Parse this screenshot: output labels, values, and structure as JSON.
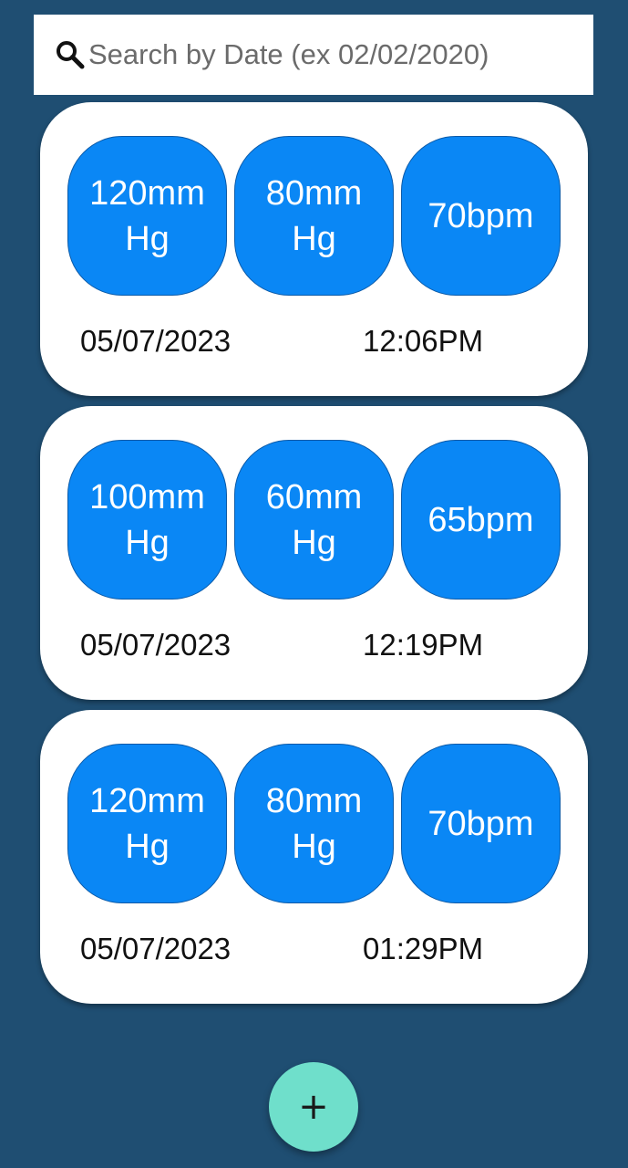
{
  "search": {
    "placeholder": "Search by Date (ex 02/02/2020)",
    "icon": "search-icon"
  },
  "records": [
    {
      "systolic": [
        "120mm",
        "Hg"
      ],
      "diastolic": [
        "80mm",
        "Hg"
      ],
      "pulse": "70bpm",
      "date": "05/07/2023",
      "time": "12:06PM"
    },
    {
      "systolic": [
        "100mm",
        "Hg"
      ],
      "diastolic": [
        "60mm",
        "Hg"
      ],
      "pulse": "65bpm",
      "date": "05/07/2023",
      "time": "12:19PM"
    },
    {
      "systolic": [
        "120mm",
        "Hg"
      ],
      "diastolic": [
        "80mm",
        "Hg"
      ],
      "pulse": "70bpm",
      "date": "05/07/2023",
      "time": "01:29PM"
    }
  ],
  "fab": {
    "label": "+",
    "icon": "plus-icon"
  },
  "colors": {
    "background": "#1f4e72",
    "badge": "#0a87f5",
    "fab": "#6fdfcb"
  }
}
